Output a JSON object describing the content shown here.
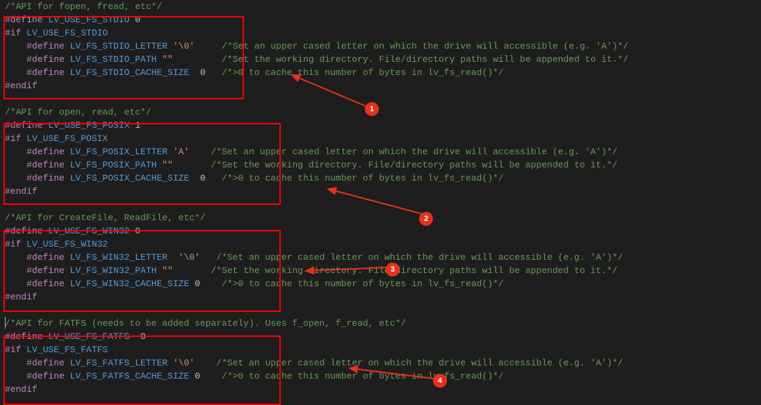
{
  "code": {
    "c1": "/*API for fopen, fread, etc*/",
    "l1_kw": "#define",
    "l1_m": " LV_USE_FS_STDIO",
    "l1_v": " 0",
    "l2_kw": "#if",
    "l2_m": " LV_USE_FS_STDIO",
    "l3_pre": "    ",
    "l3_kw": "#define",
    "l3_m": " LV_FS_STDIO_LETTER",
    "l3_v": " '\\0'",
    "l3_pad": "     ",
    "l3_c": "/*Set an upper cased letter on which the drive will accessible (e.g. 'A')*/",
    "l4_pre": "    ",
    "l4_kw": "#define",
    "l4_m": " LV_FS_STDIO_PATH",
    "l4_v": " \"\"",
    "l4_pad": "         ",
    "l4_c": "/*Set the working directory. File/directory paths will be appended to it.*/",
    "l5_pre": "    ",
    "l5_kw": "#define",
    "l5_m": " LV_FS_STDIO_CACHE_SIZE",
    "l5_v": "  0",
    "l5_pad": "   ",
    "l5_c": "/*>0 to cache this number of bytes in lv_fs_read()*/",
    "l6_kw": "#endif",
    "c2": "/*API for open, read, etc*/",
    "p1_kw": "#define",
    "p1_m": " LV_USE_FS_POSIX",
    "p1_v": " 1",
    "p2_kw": "#if",
    "p2_m": " LV_USE_FS_POSIX",
    "p3_pre": "    ",
    "p3_kw": "#define",
    "p3_m": " LV_FS_POSIX_LETTER",
    "p3_v": " 'A'",
    "p3_pad": "    ",
    "p3_c": "/*Set an upper cased letter on which the drive will accessible (e.g. 'A')*/",
    "p4_pre": "    ",
    "p4_kw": "#define",
    "p4_m": " LV_FS_POSIX_PATH",
    "p4_v": " \"\"",
    "p4_pad": "       ",
    "p4_c": "/*Set the working directory. File/directory paths will be appended to it.*/",
    "p5_pre": "    ",
    "p5_kw": "#define",
    "p5_m": " LV_FS_POSIX_CACHE_SIZE",
    "p5_v": "  0",
    "p5_pad": "   ",
    "p5_c": "/*>0 to cache this number of bytes in lv_fs_read()*/",
    "p6_kw": "#endif",
    "c3": "/*API for CreateFile, ReadFile, etc*/",
    "w1_kw": "#define",
    "w1_m": " LV_USE_FS_WIN32",
    "w1_v": " 0",
    "w2_kw": "#if",
    "w2_m": " LV_USE_FS_WIN32",
    "w3_pre": "    ",
    "w3_kw": "#define",
    "w3_m": " LV_FS_WIN32_LETTER",
    "w3_v": "  '\\0'",
    "w3_pad": "   ",
    "w3_c": "/*Set an upper cased letter on which the drive will accessible (e.g. 'A')*/",
    "w4_pre": "    ",
    "w4_kw": "#define",
    "w4_m": " LV_FS_WIN32_PATH",
    "w4_v": " \"\"",
    "w4_pad": "       ",
    "w4_c": "/*Set the working directory. File/directory paths will be appended to it.*/",
    "w5_pre": "    ",
    "w5_kw": "#define",
    "w5_m": " LV_FS_WIN32_CACHE_SIZE",
    "w5_v": " 0",
    "w5_pad": "    ",
    "w5_c": "/*>0 to cache this number of bytes in lv_fs_read()*/",
    "w6_kw": "#endif",
    "c4": "/*API for FATFS (needs to be added separately). Uses f_open, f_read, etc*/",
    "f1_kw": "#define",
    "f1_m": " LV_USE_FS_FATFS",
    "f1_v": "  0",
    "f2_kw": "#if",
    "f2_m": " LV_USE_FS_FATFS",
    "f3_pre": "    ",
    "f3_kw": "#define",
    "f3_m": " LV_FS_FATFS_LETTER",
    "f3_v": " '\\0'",
    "f3_pad": "    ",
    "f3_c": "/*Set an upper cased letter on which the drive will accessible (e.g. 'A')*/",
    "f4_pre": "    ",
    "f4_kw": "#define",
    "f4_m": " LV_FS_FATFS_CACHE_SIZE",
    "f4_v": " 0",
    "f4_pad": "    ",
    "f4_c": "/*>0 to cache this number of bytes in lv_fs_read()*/",
    "f5_kw": "#endif"
  },
  "callouts": {
    "n1": "1",
    "n2": "2",
    "n3": "3",
    "n4": "4"
  }
}
